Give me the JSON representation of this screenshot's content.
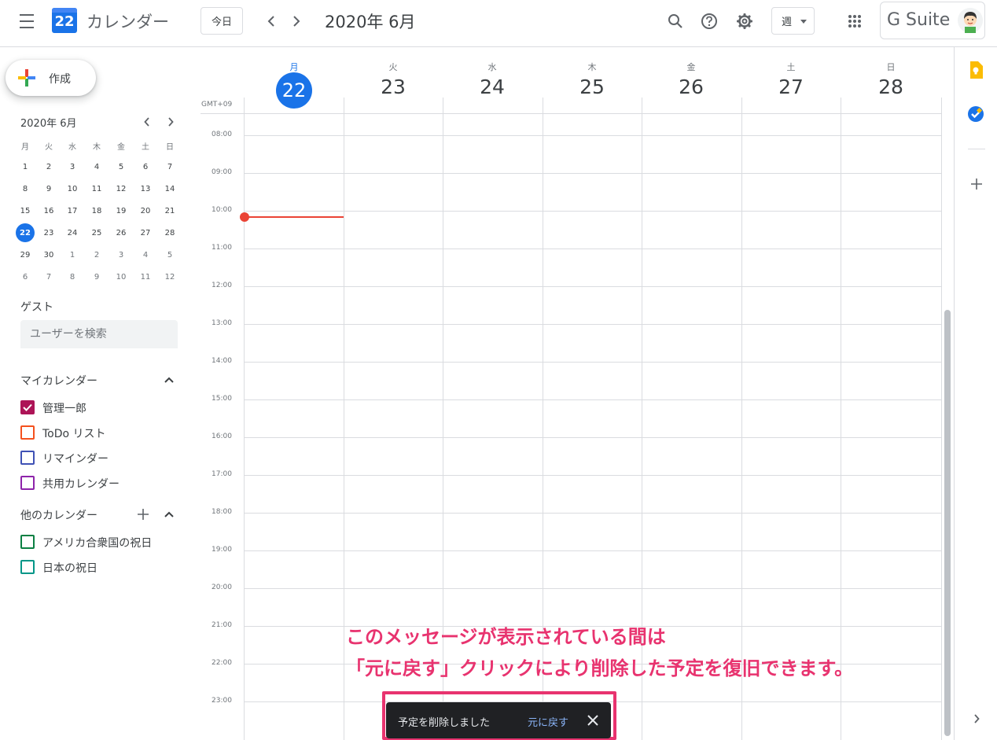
{
  "header": {
    "menu_icon": "hamburger-menu-icon",
    "logo_day": "22",
    "app_title": "カレンダー",
    "today_label": "今日",
    "date_label": "2020年 6月",
    "view_label": "週",
    "gsuite_label": "G Suite"
  },
  "sidebar": {
    "create_label": "作成",
    "mini_calendar": {
      "title": "2020年 6月",
      "weekdays": [
        "月",
        "火",
        "水",
        "木",
        "金",
        "土",
        "日"
      ],
      "weeks": [
        [
          "1",
          "2",
          "3",
          "4",
          "5",
          "6",
          "7"
        ],
        [
          "8",
          "9",
          "10",
          "11",
          "12",
          "13",
          "14"
        ],
        [
          "15",
          "16",
          "17",
          "18",
          "19",
          "20",
          "21"
        ],
        [
          "22",
          "23",
          "24",
          "25",
          "26",
          "27",
          "28"
        ],
        [
          "29",
          "30",
          "1",
          "2",
          "3",
          "4",
          "5"
        ],
        [
          "6",
          "7",
          "8",
          "9",
          "10",
          "11",
          "12"
        ]
      ],
      "today": "22"
    },
    "guest_title": "ゲスト",
    "guest_placeholder": "ユーザーを検索",
    "my_calendars_title": "マイカレンダー",
    "my_calendars": [
      {
        "label": "管理一郎",
        "color": "#ad1457",
        "checked": true
      },
      {
        "label": "ToDo リスト",
        "color": "#f4511e",
        "checked": false
      },
      {
        "label": "リマインダー",
        "color": "#3f51b5",
        "checked": false
      },
      {
        "label": "共用カレンダー",
        "color": "#8e24aa",
        "checked": false
      }
    ],
    "other_calendars_title": "他のカレンダー",
    "other_calendars": [
      {
        "label": "アメリカ合衆国の祝日",
        "color": "#0b8043",
        "checked": false
      },
      {
        "label": "日本の祝日",
        "color": "#009688",
        "checked": false
      }
    ]
  },
  "week": {
    "days": [
      {
        "name": "月",
        "num": "22",
        "today": true
      },
      {
        "name": "火",
        "num": "23"
      },
      {
        "name": "水",
        "num": "24"
      },
      {
        "name": "木",
        "num": "25"
      },
      {
        "name": "金",
        "num": "26"
      },
      {
        "name": "土",
        "num": "27"
      },
      {
        "name": "日",
        "num": "28"
      }
    ],
    "timezone": "GMT+09",
    "times": [
      "08:00",
      "09:00",
      "10:00",
      "11:00",
      "12:00",
      "13:00",
      "14:00",
      "15:00",
      "16:00",
      "17:00",
      "18:00",
      "19:00",
      "20:00",
      "21:00",
      "22:00",
      "23:00"
    ]
  },
  "annotation": {
    "line1": "このメッセージが表示されている間は",
    "line2": "「元に戻す」クリックにより削除した予定を復旧できます。"
  },
  "snackbar": {
    "message": "予定を削除しました",
    "undo_label": "元に戻す"
  },
  "colors": {
    "accent": "#1a73e8",
    "now_line": "#ea4335",
    "annotation": "#e8336f"
  }
}
